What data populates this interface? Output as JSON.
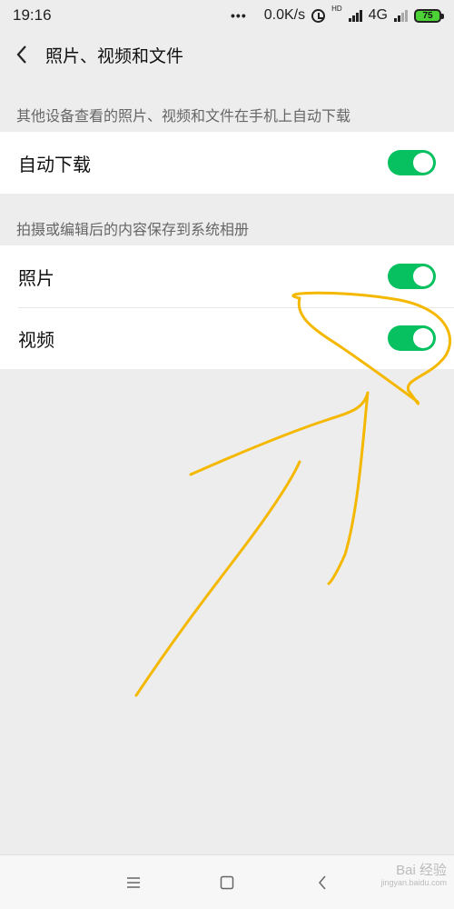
{
  "status_bar": {
    "time": "19:16",
    "dots": "•••",
    "speed": "0.0K/s",
    "hd_label": "HD",
    "network": "4G",
    "battery": "75"
  },
  "nav": {
    "title": "照片、视频和文件"
  },
  "sections": [
    {
      "header": "其他设备查看的照片、视频和文件在手机上自动下载",
      "rows": [
        {
          "label": "自动下载",
          "toggle_on": true
        }
      ]
    },
    {
      "header": "拍摄或编辑后的内容保存到系统相册",
      "rows": [
        {
          "label": "照片",
          "toggle_on": true
        },
        {
          "label": "视频",
          "toggle_on": true
        }
      ]
    }
  ],
  "colors": {
    "toggle_on": "#07c160",
    "annotation": "#f5b800"
  },
  "watermark": {
    "text": "Bai 经验",
    "sub": "jingyan.baidu.com"
  }
}
